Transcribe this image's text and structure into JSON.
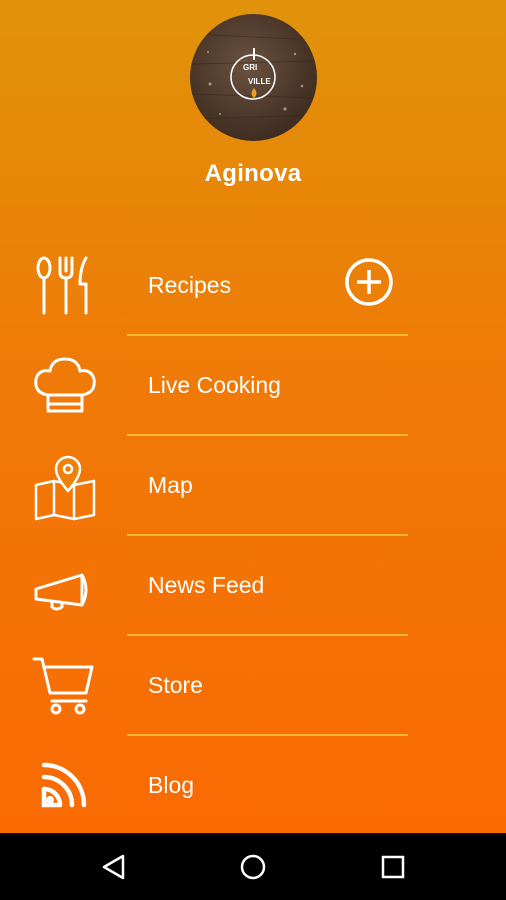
{
  "profile": {
    "name": "Aginova",
    "avatar_icon": "grill-ville-logo",
    "avatar_logo_text": [
      "GRI",
      "VILLE"
    ]
  },
  "menu": {
    "items": [
      {
        "label": "Recipes",
        "icon": "cutlery-icon",
        "action_icon": "add-circle-icon"
      },
      {
        "label": "Live Cooking",
        "icon": "chef-hat-icon"
      },
      {
        "label": "Map",
        "icon": "map-pin-icon"
      },
      {
        "label": "News Feed",
        "icon": "megaphone-icon"
      },
      {
        "label": "Store",
        "icon": "shopping-cart-icon"
      },
      {
        "label": "Blog",
        "icon": "rss-feed-icon"
      }
    ]
  },
  "colors": {
    "gradient_top": "#e0930a",
    "gradient_bottom": "#fa6a03",
    "divider": "#f7c43a",
    "text": "#ffffff",
    "navbar": "#000000"
  },
  "system_nav": {
    "buttons": [
      "back-icon",
      "home-icon",
      "recents-icon"
    ]
  }
}
